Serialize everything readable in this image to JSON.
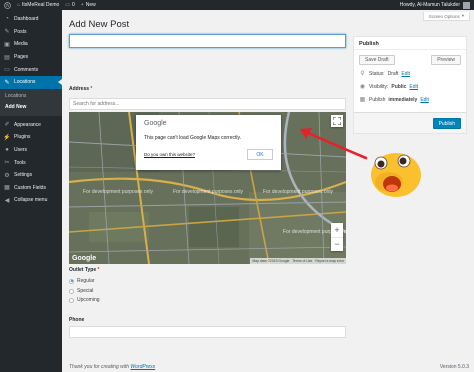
{
  "adminbar": {
    "site_name": "ItsMeReal Demo",
    "comments_count": "0",
    "new_label": "New",
    "greeting": "Howdy, Al-Mamun Talukder"
  },
  "sidebar": {
    "items": [
      {
        "label": "Dashboard",
        "icon": "dashboard-icon",
        "glyph": "◔"
      },
      {
        "label": "Posts",
        "icon": "pin-icon",
        "glyph": "✎"
      },
      {
        "label": "Media",
        "icon": "media-icon",
        "glyph": "▣"
      },
      {
        "label": "Pages",
        "icon": "pages-icon",
        "glyph": "▤"
      },
      {
        "label": "Comments",
        "icon": "comment-icon",
        "glyph": "▭"
      },
      {
        "label": "Locations",
        "icon": "location-icon",
        "glyph": "✎"
      }
    ],
    "sub_items": [
      "Locations",
      "Add New"
    ],
    "items2": [
      {
        "label": "Appearance",
        "icon": "appearance-icon",
        "glyph": "✐"
      },
      {
        "label": "Plugins",
        "icon": "plugin-icon",
        "glyph": "⚡"
      },
      {
        "label": "Users",
        "icon": "users-icon",
        "glyph": "●"
      },
      {
        "label": "Tools",
        "icon": "tools-icon",
        "glyph": "✂"
      },
      {
        "label": "Settings",
        "icon": "settings-icon",
        "glyph": "⚙"
      },
      {
        "label": "Custom Fields",
        "icon": "fields-icon",
        "glyph": "▦"
      },
      {
        "label": "Collapse menu",
        "icon": "collapse-icon",
        "glyph": "◀"
      }
    ]
  },
  "main": {
    "page_title": "Add New Post",
    "screen_options": "Screen Options",
    "address_label": "Address",
    "required_mark": "*",
    "address_placeholder": "Search for address...",
    "outlet_type_label": "Outlet Type",
    "outlet_options": [
      "Regular",
      "Special",
      "Upcoming"
    ],
    "outlet_selected": "Regular",
    "phone_label": "Phone",
    "footer_thanks": "Thank you for creating with",
    "footer_link": "WordPress",
    "version": "Version 5.0.3"
  },
  "map": {
    "error_logo": "Google",
    "error_message": "This page can't load Google Maps correctly.",
    "own_site_link": "Do you own this website?",
    "ok_label": "OK",
    "dev_watermark": "For development purposes only",
    "logo": "Google",
    "attribution": [
      "Map data ©2019 Google",
      "Terms of Use",
      "Report a map error"
    ]
  },
  "publish": {
    "title": "Publish",
    "save_draft": "Save Draft",
    "preview": "Preview",
    "status_label": "Status:",
    "status_value": "Draft",
    "visibility_label": "Visibility:",
    "visibility_value": "Public",
    "schedule_label": "Publish",
    "schedule_value": "immediately",
    "edit_label": "Edit",
    "publish_button": "Publish"
  }
}
